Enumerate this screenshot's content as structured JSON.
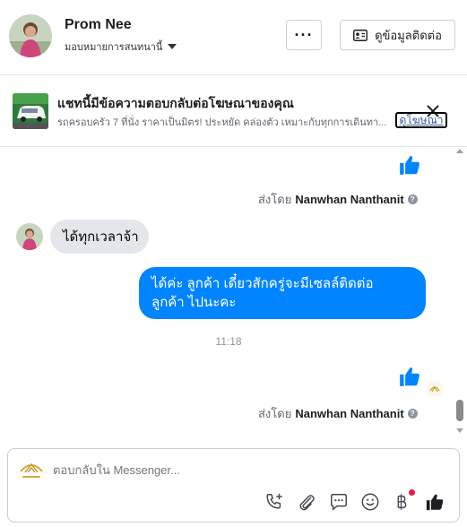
{
  "header": {
    "contact_name": "Prom Nee",
    "assignment_label": "มอบหมายการสนทนานี้",
    "more_label": "···",
    "view_contact_label": "ดูข้อมูลติดต่อ"
  },
  "ad": {
    "title": "แชทนี้มีข้อความตอบกลับต่อโฆษณาของคุณ",
    "description": "รถครอบครัว 7 ที่นั่ง ราคาเป็นมิตร! ประหยัด คล่องตัว เหมาะกับทุกการเดินทา...",
    "view_ad_label": "ดูโฆษณา"
  },
  "messages": {
    "sent_by_prefix": "ส่งโดย",
    "sender_name": "Nanwhan Nanthanit",
    "incoming_text": "ได้ทุกเวลาจ้า",
    "outgoing_line1": "ได้ค่ะ  ลูกค้า   เดี๋ยวสักครู่จะมีเซลล์ติดต่อ",
    "outgoing_line2": "ลูกค้า  ไปนะคะ",
    "timestamp": "11:18"
  },
  "composer": {
    "placeholder": "ตอบกลับใน Messenger..."
  },
  "colors": {
    "accent": "#0084ff",
    "incoming_bubble": "#e4e6eb",
    "notification": "#e41e3f"
  },
  "icons": [
    "more-icon",
    "contact-card-icon",
    "close-icon",
    "thumbs-up-icon",
    "help-icon",
    "phone-add-icon",
    "attachment-icon",
    "saved-reply-icon",
    "emoji-icon",
    "baht-payment-icon"
  ]
}
